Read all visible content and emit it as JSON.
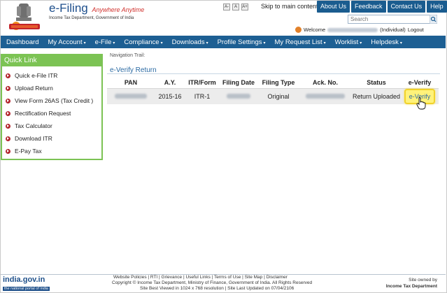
{
  "header": {
    "brand": "e-Filing",
    "tagline": "Anywhere Anytime",
    "subtitle": "Income Tax Department, Government of India",
    "font_buttons": [
      "A-",
      "A",
      "A+"
    ],
    "skip_link": "Skip to main content",
    "top_buttons": [
      "About Us",
      "Feedback",
      "Contact Us",
      "Help"
    ],
    "search_placeholder": "Search",
    "welcome_prefix": "Welcome",
    "welcome_suffix": "(Individual)",
    "logout": "Logout"
  },
  "nav": {
    "items": [
      "Dashboard",
      "My Account",
      "e-File",
      "Compliance",
      "Downloads",
      "Profile Settings",
      "My Request List",
      "Worklist",
      "Helpdesk"
    ]
  },
  "quick_link": {
    "title": "Quick Link",
    "items": [
      "Quick e-File ITR",
      "Upload Return",
      "View Form 26AS (Tax Credit )",
      "Rectification Request",
      "Tax Calculator",
      "Download ITR",
      "E-Pay Tax"
    ]
  },
  "main": {
    "trail": "Navigation Trail:",
    "title": "e-Verify Return",
    "columns": [
      "PAN",
      "A.Y.",
      "ITR/Form",
      "Filing Date",
      "Filing Type",
      "Ack. No.",
      "Status",
      "e-Verify"
    ],
    "row": {
      "ay": "2015-16",
      "itr": "ITR-1",
      "filing_type": "Original",
      "status": "Return Uploaded",
      "action": "e-Verify"
    }
  },
  "footer": {
    "india_main": "india.gov.in",
    "india_sub": "the national portal of india",
    "links": "Website Policies  |  RTI  |  Grievance  |  Useful Links  |  Terms of Use  |  Site Map  |  Disclaimer",
    "copyright": "Copyright © Income Tax Department, Ministry of Finance, Government of India. All Rights Reserved",
    "best_viewed": "Site Best Viewed in 1024 x 768 resolution | Site Last Updated on 07/04/2106",
    "owned_1": "Site owned by",
    "owned_2": "Income Tax Department"
  },
  "colors": {
    "nav_bg": "#1d5f93",
    "quick_green": "#7cc354",
    "link_blue": "#2b6aa3",
    "highlight_yellow": "#fff27a"
  }
}
